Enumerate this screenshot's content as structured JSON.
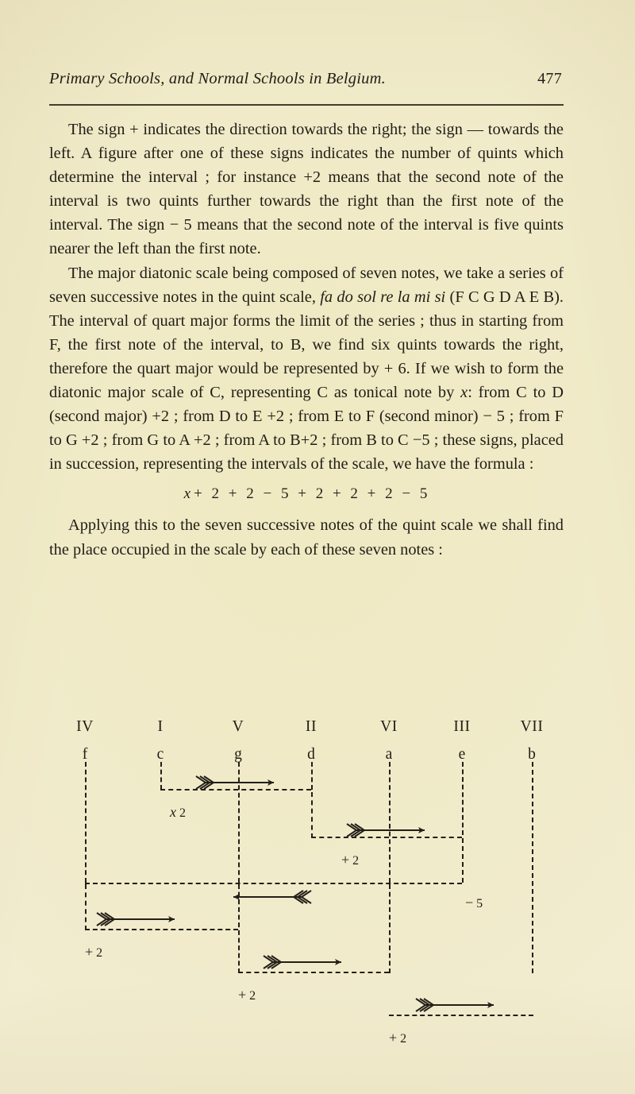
{
  "running_head": {
    "title": "Primary Schools, and Normal Schools in Belgium.",
    "folio": "477"
  },
  "paragraphs": {
    "p1_a": "The sign + indicates the direction towards the right; the sign — towards the left. A figure after one of these signs indicates the number of quints which determine the interval ; for instance +2 means that the second note of the interval is two quints further towards the right than the first note of the interval. The sign ",
    "p1_sign": "− 5",
    "p1_b": " means that the second note of the interval is five quints nearer the left than the first note.",
    "p2_a": "The major diatonic scale being composed of seven notes, we take a series of seven successive notes in the quint scale, ",
    "p2_solfa": "fa do sol re la mi si",
    "p2_b": " (F C G D A E B). The interval of quart major forms the limit of the series ; thus in starting from F, the first note of the interval, to B, we find six quints towards the right, therefore the quart major would be represented by + 6. If we wish to form the diatonic major scale of C, representing C as tonical note by ",
    "p2_x": "x",
    "p2_c": ": from C to D (second major) +2 ; from D to E +2 ; from E to F (second minor) − 5 ; from F to G +2 ; from G to A +2 ; from A to B+2 ; from B to C −5 ; these signs, placed in succession, representing the intervals of the scale, we have the formula :",
    "p3": "Applying this to the seven successive notes of the quint scale we shall find the place occupied in the scale by each of these seven notes :"
  },
  "formula": {
    "variable": "x",
    "terms": "+ 2 + 2 − 5 + 2 + 2 + 2 − 5"
  },
  "diagram": {
    "degree_labels": [
      "IV",
      "I",
      "V",
      "II",
      "VI",
      "III",
      "VII"
    ],
    "note_labels": [
      "f",
      "c",
      "g",
      "d",
      "a",
      "e",
      "b"
    ],
    "connector_labels": [
      {
        "id": "c-to-g",
        "sign": "x",
        "value": "2"
      },
      {
        "id": "d-to-e",
        "sign": "+",
        "value": "2"
      },
      {
        "id": "d-to-g-back",
        "sign": "−",
        "value": "5"
      },
      {
        "id": "f-to-g",
        "sign": "+",
        "value": "2"
      },
      {
        "id": "g-to-a",
        "sign": "+",
        "value": "2"
      },
      {
        "id": "a-to-b",
        "sign": "+",
        "value": "2"
      }
    ]
  },
  "colors": {
    "paper": "#f2ecd2",
    "ink": "#211d16",
    "rule": "#2a251b"
  }
}
